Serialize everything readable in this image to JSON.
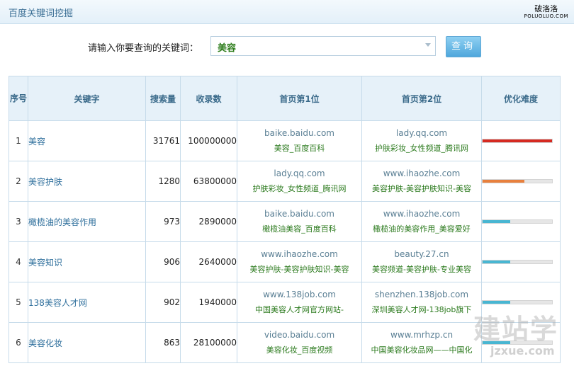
{
  "app": {
    "title": "百度关键词挖掘"
  },
  "brand": {
    "name": "破洛洛",
    "domain": "POLUOLUO.COM"
  },
  "search": {
    "label": "请输入你要查询的关键词：",
    "value": "美容",
    "button_label": "查询"
  },
  "table": {
    "headers": [
      "序号",
      "关键字",
      "搜索量",
      "收录数",
      "首页第1位",
      "首页第2位",
      "优化难度"
    ],
    "rows": [
      {
        "index": "1",
        "keyword": "美容",
        "searches": "31761",
        "indexed": "100000000",
        "first_url": "baike.baidu.com",
        "first_title": "美容_百度百科",
        "second_url": "lady.qq.com",
        "second_title": "护肤彩妆_女性频道_腾讯网",
        "difficulty": 1.0,
        "difficulty_color": "#d62a21"
      },
      {
        "index": "2",
        "keyword": "美容护肤",
        "searches": "1280",
        "indexed": "63800000",
        "first_url": "lady.qq.com",
        "first_title": "护肤彩妆_女性频道_腾讯网",
        "second_url": "www.ihaozhe.com",
        "second_title": "美容护肤-美容护肤知识-美容",
        "difficulty": 0.6,
        "difficulty_color": "#e8803d"
      },
      {
        "index": "3",
        "keyword": "橄榄油的美容作用",
        "searches": "973",
        "indexed": "2890000",
        "first_url": "baike.baidu.com",
        "first_title": "橄榄油美容_百度百科",
        "second_url": "www.ihaozhe.com",
        "second_title": "橄榄油的美容作用_美容爱好",
        "difficulty": 0.4,
        "difficulty_color": "#48b6d2"
      },
      {
        "index": "4",
        "keyword": "美容知识",
        "searches": "906",
        "indexed": "2640000",
        "first_url": "www.ihaozhe.com",
        "first_title": "美容护肤-美容护肤知识-美容",
        "second_url": "beauty.27.cn",
        "second_title": "美容频道-美容护肤-专业美容",
        "difficulty": 0.4,
        "difficulty_color": "#48b6d2"
      },
      {
        "index": "5",
        "keyword": "138美容人才网",
        "searches": "902",
        "indexed": "1940000",
        "first_url": "www.138job.com",
        "first_title": "中国美容人才网官方网站-",
        "second_url": "shenzhen.138job.com",
        "second_title": "深圳美容人才网-138job旗下",
        "difficulty": 0.4,
        "difficulty_color": "#48b6d2"
      },
      {
        "index": "6",
        "keyword": "美容化妆",
        "searches": "863",
        "indexed": "28100000",
        "first_url": "video.baidu.com",
        "first_title": "美容化妆_百度视频",
        "second_url": "www.mrhzp.cn",
        "second_title": "中国美容化妆品网——中国化",
        "difficulty": 0.4,
        "difficulty_color": "#48b6d2"
      }
    ]
  },
  "watermark": {
    "main": "建站学",
    "sub": "jzxue.com"
  }
}
